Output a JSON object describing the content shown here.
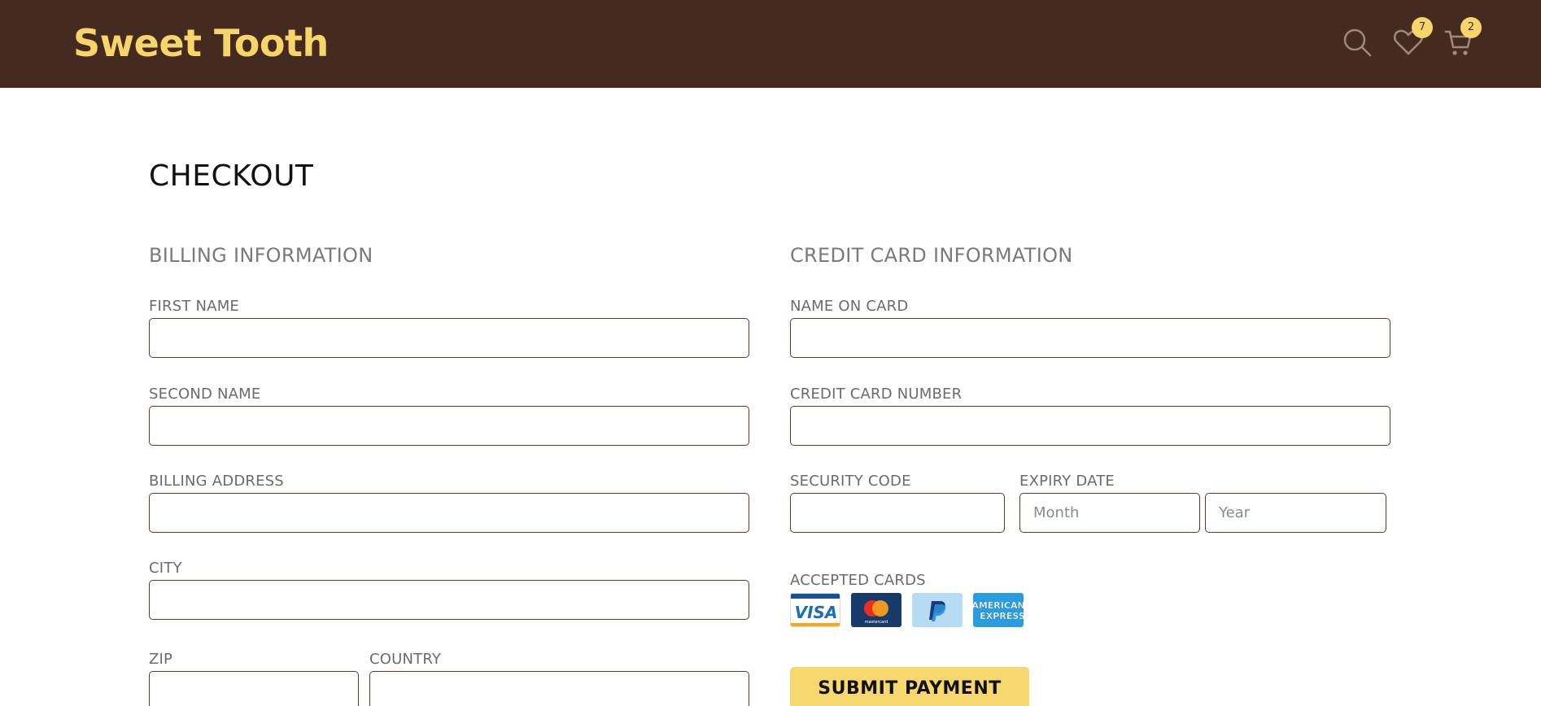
{
  "header": {
    "logo": "Sweet Tooth",
    "search_icon": "search-icon",
    "wishlist_icon": "heart-icon",
    "wishlist_count": "7",
    "cart_icon": "cart-icon",
    "cart_count": "2"
  },
  "page": {
    "title": "CHECKOUT"
  },
  "billing": {
    "title": "BILLING INFORMATION",
    "first_name_label": "FIRST NAME",
    "second_name_label": "SECOND NAME",
    "address_label": "BILLING ADDRESS",
    "city_label": "CITY",
    "zip_label": "ZIP",
    "country_label": "COUNTRY"
  },
  "card": {
    "title": "CREDIT CARD INFORMATION",
    "name_label": "NAME ON CARD",
    "number_label": "CREDIT CARD NUMBER",
    "security_label": "SECURITY CODE",
    "expiry_label": "EXPIRY DATE",
    "month_placeholder": "Month",
    "year_placeholder": "Year",
    "accepted_label": "ACCEPTED CARDS",
    "accepted": [
      "visa",
      "mastercard",
      "paypal",
      "american-express"
    ],
    "visa_text": "VISA",
    "mastercard_text": "mastercard",
    "amex_text_1": "AMERICAN",
    "amex_text_2": "EXPRESS"
  },
  "submit_label": "SUBMIT PAYMENT",
  "colors": {
    "header_bg": "#452a20",
    "brand_yellow": "#f6d56a",
    "input_border": "#5a3a30",
    "section_gray": "#7a7a7a"
  }
}
